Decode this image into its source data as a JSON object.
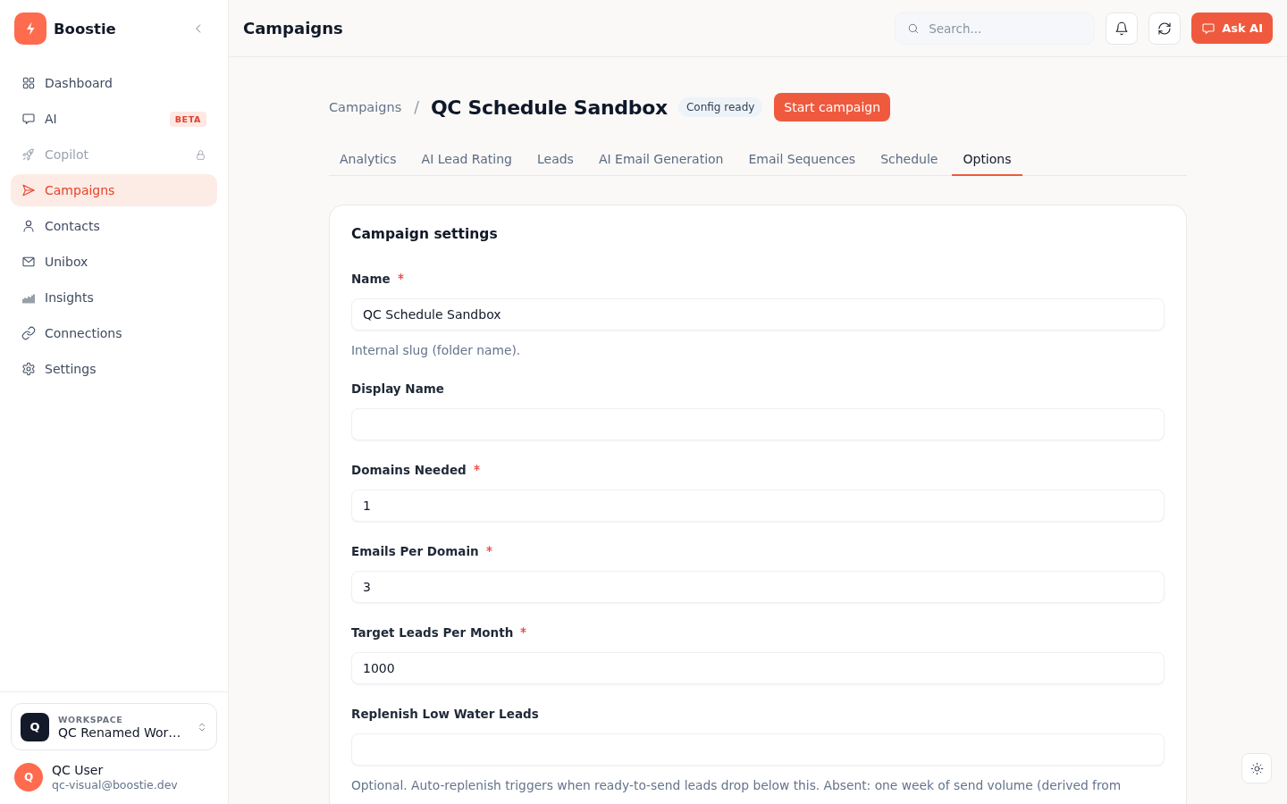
{
  "sidebar": {
    "brand": "Boostie",
    "items": [
      {
        "label": "Dashboard",
        "selected": false,
        "disabled": false,
        "locked": false
      },
      {
        "label": "AI",
        "badge": "BETA",
        "selected": false,
        "disabled": false,
        "locked": false
      },
      {
        "label": "Copilot",
        "selected": false,
        "disabled": true,
        "locked": true
      },
      {
        "label": "Campaigns",
        "selected": true,
        "disabled": false,
        "locked": false
      },
      {
        "label": "Contacts",
        "selected": false,
        "disabled": false,
        "locked": false
      },
      {
        "label": "Unibox",
        "selected": false,
        "disabled": false,
        "locked": false
      },
      {
        "label": "Insights",
        "selected": false,
        "disabled": false,
        "locked": false
      },
      {
        "label": "Connections",
        "selected": false,
        "disabled": false,
        "locked": false
      },
      {
        "label": "Settings",
        "selected": false,
        "disabled": false,
        "locked": false
      }
    ],
    "workspace": {
      "caption": "WORKSPACE",
      "initial": "Q",
      "name": "QC Renamed Wor…"
    },
    "user": {
      "initial": "Q",
      "name": "QC User",
      "email": "qc-visual@boostie.dev"
    }
  },
  "topbar": {
    "title": "Campaigns",
    "search": {
      "placeholder": "Search..."
    },
    "ask_button": "Ask AI"
  },
  "header": {
    "breadcrumb": "Campaigns",
    "separator": "/",
    "title": "QC Schedule Sandbox",
    "status": "Config ready",
    "action": "Start campaign"
  },
  "tabs": [
    {
      "label": "Analytics",
      "selected": false
    },
    {
      "label": "AI Lead Rating",
      "selected": false
    },
    {
      "label": "Leads",
      "selected": false
    },
    {
      "label": "AI Email Generation",
      "selected": false
    },
    {
      "label": "Email Sequences",
      "selected": false
    },
    {
      "label": "Schedule",
      "selected": false
    },
    {
      "label": "Options",
      "selected": true
    }
  ],
  "card": {
    "title": "Campaign settings",
    "fields": [
      {
        "label": "Name",
        "required": true,
        "value": "QC Schedule Sandbox",
        "help": "Internal slug (folder name)."
      },
      {
        "label": "Display Name",
        "required": false
      },
      {
        "label": "Domains Needed",
        "required": true,
        "value": "1"
      },
      {
        "label": "Emails Per Domain",
        "required": true,
        "value": "3"
      },
      {
        "label": "Target Leads Per Month",
        "required": true,
        "value": "1000"
      },
      {
        "label": "Replenish Low Water Leads",
        "required": false,
        "help": "Optional. Auto-replenish triggers when ready-to-send leads drop below this. Absent: one week of send volume (derived from"
      }
    ]
  }
}
